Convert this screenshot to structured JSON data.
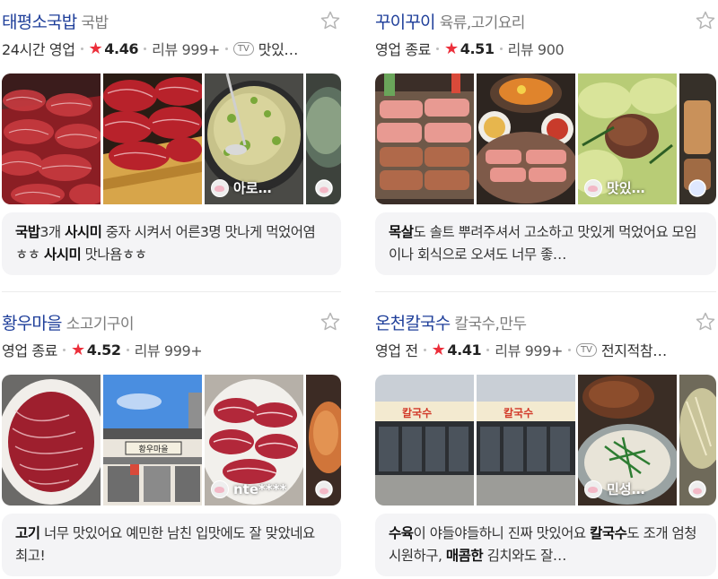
{
  "cards": [
    {
      "name": "태평소국밥",
      "category": "국밥",
      "status": "24시간 영업",
      "rating": "4.46",
      "reviews": "리뷰 999+",
      "tv_badge": "TV",
      "tv_text": "맛있…",
      "photo_user": "아로…",
      "review_segments": [
        {
          "text": "국밥",
          "bold": true
        },
        {
          "text": "3개 ",
          "bold": false
        },
        {
          "text": "사시미",
          "bold": true
        },
        {
          "text": " 중자 시켜서 어른3명 맛나게 먹었어염ㅎㅎ ",
          "bold": false
        },
        {
          "text": "사시미",
          "bold": true
        },
        {
          "text": " 맛나욤ㅎㅎ",
          "bold": false
        }
      ]
    },
    {
      "name": "꾸이꾸이",
      "category": "육류,고기요리",
      "status": "영업 종료",
      "rating": "4.51",
      "reviews": "리뷰 900",
      "photo_user": "맛있…",
      "review_segments": [
        {
          "text": "목살",
          "bold": true
        },
        {
          "text": "도 솔트 뿌려주셔서 고소하고 맛있게 먹었어요 모임이나 회식으로 오셔도 너무 좋…",
          "bold": false
        }
      ]
    },
    {
      "name": "황우마을",
      "category": "소고기구이",
      "status": "영업 종료",
      "rating": "4.52",
      "reviews": "리뷰 999+",
      "photo_user": "nte****",
      "review_segments": [
        {
          "text": "고기",
          "bold": true
        },
        {
          "text": " 너무 맛있어요 예민한 남친 입맛에도 잘 맞았네요 최고!",
          "bold": false
        }
      ]
    },
    {
      "name": "온천칼국수",
      "category": "칼국수,만두",
      "status": "영업 전",
      "rating": "4.41",
      "reviews": "리뷰 999+",
      "tv_badge": "TV",
      "tv_text": "전지적참…",
      "photo_user": "민성…",
      "review_segments": [
        {
          "text": "수육",
          "bold": true
        },
        {
          "text": "이 야들야들하니 진짜 맛있어요 ",
          "bold": false
        },
        {
          "text": "칼국수",
          "bold": true
        },
        {
          "text": "도 조개 엄청 시원하구, ",
          "bold": false
        },
        {
          "text": "매콤한",
          "bold": true
        },
        {
          "text": " 김치와도 잘…",
          "bold": false
        }
      ]
    }
  ],
  "signboard": {
    "text_a": "칼국수",
    "text_b": "황우마을"
  },
  "colors": {
    "name": "#1f3f9a",
    "rating_star": "#ec2f3b",
    "review_bg": "#f4f4f6"
  }
}
